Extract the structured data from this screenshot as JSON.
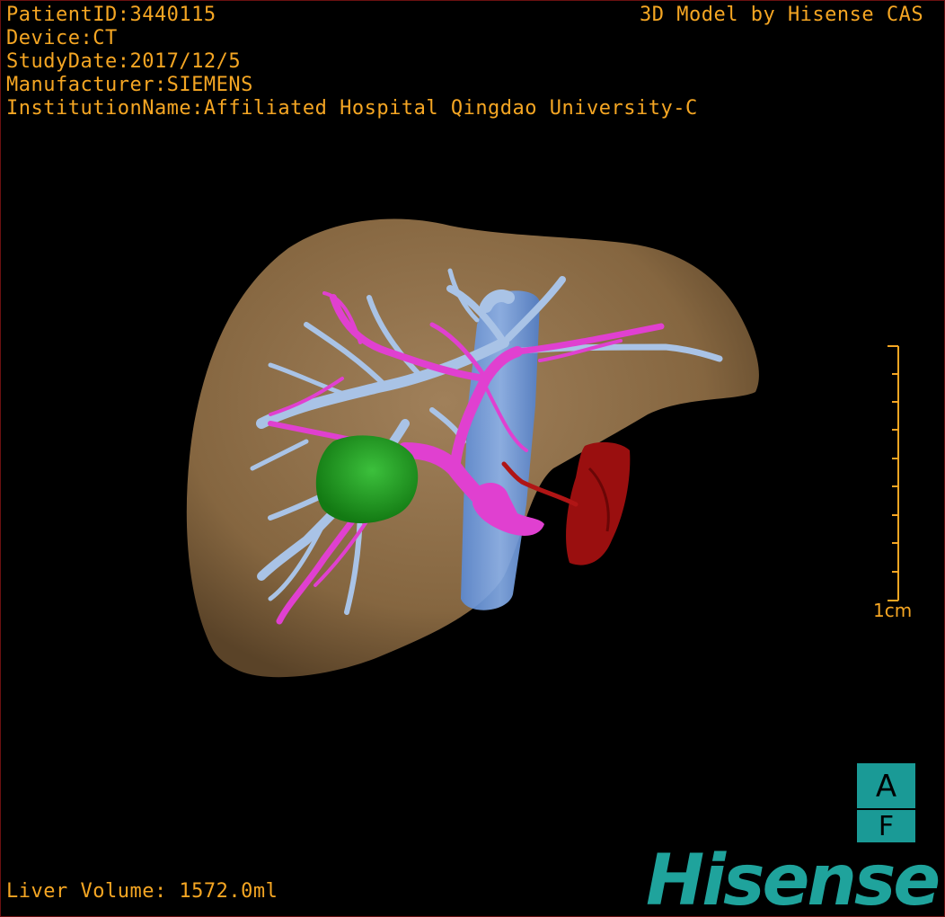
{
  "overlay": {
    "patient_id": "PatientID:3440115",
    "device": "Device:CT",
    "study_date": "StudyDate:2017/12/5",
    "manufacturer": "Manufacturer:SIEMENS",
    "institution": "InstitutionName:Affiliated Hospital Qingdao University-C",
    "model_credit": "3D Model by Hisense CAS",
    "liver_volume": "Liver Volume: 1572.0ml"
  },
  "scale": {
    "label": "1cm"
  },
  "orientation": {
    "top": "A",
    "bottom": "F"
  },
  "brand": {
    "logo_text": "Hisense"
  },
  "colors": {
    "overlay_text": "#f5a623",
    "liver": "#8a6a42",
    "hepatic_veins": "#a9c3e6",
    "portal_vein": "#e040d0",
    "ivc": "#6f9ee0",
    "tumor": "#1f9a1f",
    "artery": "#a01010",
    "brand": "#1fa39c"
  }
}
